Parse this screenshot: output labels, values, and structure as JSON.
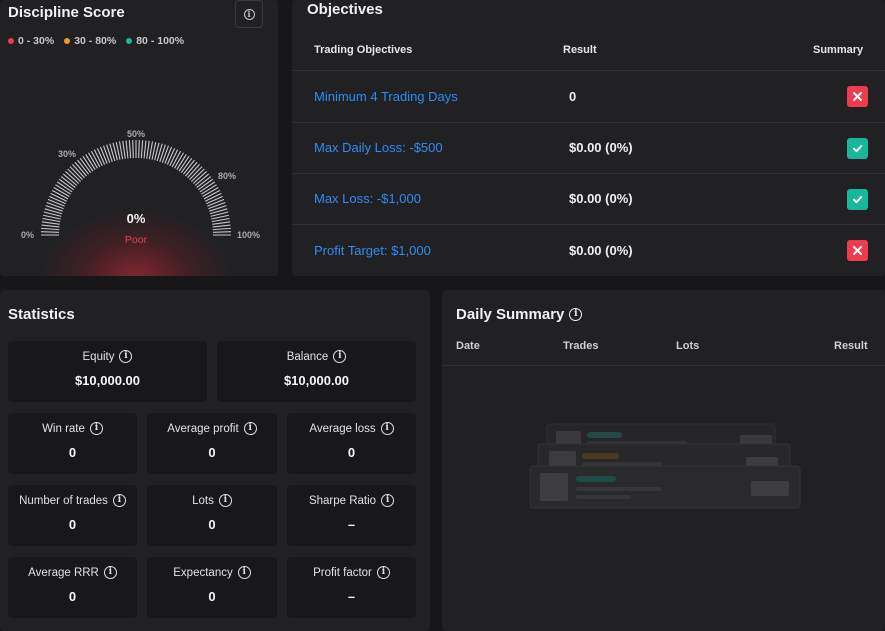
{
  "discipline": {
    "title": "Discipline Score",
    "legend": [
      {
        "label": "0 - 30%",
        "color": "#ee3b4e"
      },
      {
        "label": "30 - 80%",
        "color": "#f39a1d"
      },
      {
        "label": "80 - 100%",
        "color": "#18b79b"
      }
    ],
    "gauge_labels": [
      "0%",
      "30%",
      "50%",
      "80%",
      "100%"
    ],
    "score": "0%",
    "score_value": 0,
    "rating": "Poor"
  },
  "objectives": {
    "title": "Objectives",
    "headers": {
      "name": "Trading Objectives",
      "result": "Result",
      "summary": "Summary"
    },
    "rows": [
      {
        "name": "Minimum 4 Trading Days",
        "result": "0",
        "status": "fail"
      },
      {
        "name": "Max Daily Loss: -$500",
        "result": "$0.00 (0%)",
        "status": "pass"
      },
      {
        "name": "Max Loss: -$1,000",
        "result": "$0.00 (0%)",
        "status": "pass"
      },
      {
        "name": "Profit Target: $1,000",
        "result": "$0.00 (0%)",
        "status": "fail"
      }
    ]
  },
  "statistics": {
    "title": "Statistics",
    "equity": {
      "label": "Equity",
      "value": "$10,000.00"
    },
    "balance": {
      "label": "Balance",
      "value": "$10,000.00"
    },
    "win_rate": {
      "label": "Win rate",
      "value": "0"
    },
    "average_profit": {
      "label": "Average profit",
      "value": "0"
    },
    "average_loss": {
      "label": "Average loss",
      "value": "0"
    },
    "number_of_trades": {
      "label": "Number of trades",
      "value": "0"
    },
    "lots": {
      "label": "Lots",
      "value": "0"
    },
    "sharpe_ratio": {
      "label": "Sharpe Ratio",
      "value": "–"
    },
    "average_rrr": {
      "label": "Average RRR",
      "value": "0"
    },
    "expectancy": {
      "label": "Expectancy",
      "value": "0"
    },
    "profit_factor": {
      "label": "Profit factor",
      "value": "–"
    }
  },
  "daily_summary": {
    "title": "Daily Summary",
    "headers": {
      "date": "Date",
      "trades": "Trades",
      "lots": "Lots",
      "result": "Result"
    }
  }
}
